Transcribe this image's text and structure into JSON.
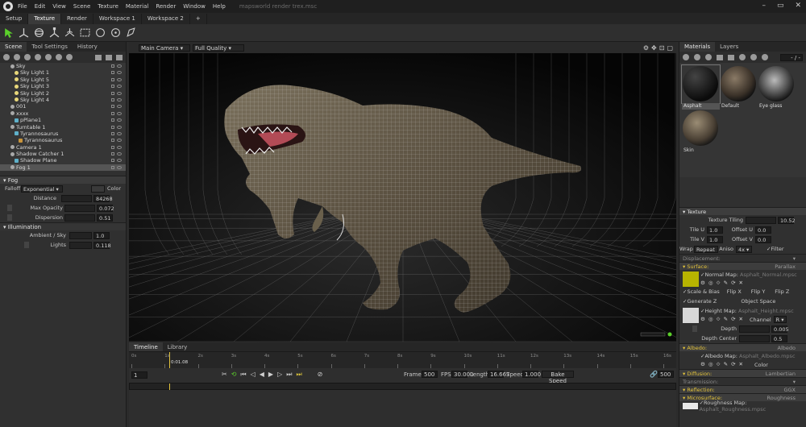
{
  "window": {
    "menu": [
      "File",
      "Edit",
      "View",
      "Scene",
      "Texture",
      "Material",
      "Render",
      "Window",
      "Help"
    ],
    "document": "mapsworld render trex.msc",
    "controls": [
      "–",
      "▭",
      "✕"
    ]
  },
  "workspace_tabs": [
    "Setup",
    "Texture",
    "Render",
    "Workspace 1",
    "Workspace 2",
    "+"
  ],
  "active_workspace_tab": 1,
  "colors": {
    "accent": "#e0b400",
    "select_green": "#5bd02b",
    "gold": "#e3c33b"
  },
  "left": {
    "tabs": [
      "Scene",
      "Tool Settings",
      "History"
    ],
    "tree": [
      {
        "label": "Sky",
        "indent": 1,
        "icon": "sky"
      },
      {
        "label": "Sky Light 1",
        "indent": 2,
        "icon": "light"
      },
      {
        "label": "Sky Light 5",
        "indent": 2,
        "icon": "light"
      },
      {
        "label": "Sky Light 3",
        "indent": 2,
        "icon": "light"
      },
      {
        "label": "Sky Light 2",
        "indent": 2,
        "icon": "light"
      },
      {
        "label": "Sky Light 4",
        "indent": 2,
        "icon": "light"
      },
      {
        "label": "001",
        "indent": 1,
        "icon": "group"
      },
      {
        "label": "xxxx",
        "indent": 1,
        "icon": "group"
      },
      {
        "label": "pPlane1",
        "indent": 2,
        "icon": "mesh"
      },
      {
        "label": "Turntable 1",
        "indent": 1,
        "icon": "turntable"
      },
      {
        "label": "Tyrannosaurus",
        "indent": 2,
        "icon": "mesh"
      },
      {
        "label": "Tyrannosaurus",
        "indent": 3,
        "icon": "dino"
      },
      {
        "label": "Camera 1",
        "indent": 1,
        "icon": "camera"
      },
      {
        "label": "Shadow Catcher 1",
        "indent": 1,
        "icon": "group"
      },
      {
        "label": "Shadow Plane",
        "indent": 2,
        "icon": "mesh"
      },
      {
        "label": "Fog 1",
        "indent": 1,
        "icon": "fog",
        "selected": true
      }
    ],
    "fog_section": "Fog",
    "falloff_label": "Falloff",
    "falloff_value": "Exponential",
    "color_label": "Color",
    "distance_label": "Distance",
    "distance_value": "84268",
    "max_opacity_label": "Max Opacity",
    "max_opacity_value": "0.072",
    "dispersion_label": "Dispersion",
    "dispersion_value": "0.51",
    "illumination_section": "Illumination",
    "ambient_label": "Ambient / Sky",
    "ambient_value": "1.0",
    "lights_label": "Lights",
    "lights_value": "0.118"
  },
  "viewport": {
    "camera": "Main Camera",
    "quality": "Full Quality"
  },
  "timeline": {
    "tabs": [
      "Timeline",
      "Library"
    ],
    "ticks": [
      "0s",
      "1s",
      "2s",
      "3s",
      "4s",
      "5s",
      "6s",
      "7s",
      "8s",
      "9s",
      "10s",
      "11s",
      "12s",
      "13s",
      "14s",
      "15s",
      "16s"
    ],
    "current_time": "0:01.08",
    "frame_field": "1",
    "frames_label": "Frames",
    "frames_value": "500",
    "fps_label": "FPS",
    "fps_value": "30.000",
    "length_label": "Length",
    "length_value": "16.667",
    "speed_label": "Speed",
    "speed_value": "1.000",
    "bake_label": "Bake Speed",
    "end_frame": "500"
  },
  "right": {
    "tabs": [
      "Materials",
      "Layers"
    ],
    "page": "- / -",
    "materials": [
      "Asphalt",
      "Default",
      "Eye glass",
      "Skin"
    ],
    "texture_section": "Texture",
    "texture_tiling_label": "Texture Tiling",
    "texture_tiling_value": "10.52",
    "tile_u_label": "Tile U",
    "tile_u_value": "1.0",
    "offset_u_label": "Offset U",
    "offset_u_value": "0.0",
    "tile_v_label": "Tile V",
    "tile_v_value": "1.0",
    "offset_v_label": "Offset V",
    "offset_v_value": "0.0",
    "wrap_label": "Wrap",
    "wrap_value": "Repeat",
    "aniso_label": "Aniso",
    "aniso_value": "4x",
    "filter_label": "Filter",
    "displacement_label": "Displacement:",
    "surface_label": "Surface:",
    "surface_value": "Parallax",
    "normal_map_label": "Normal Map:",
    "normal_map_file": "Asphalt_Normal.mpsc",
    "scale_bias_label": "Scale & Bias",
    "flip_x": "Flip X",
    "flip_y": "Flip Y",
    "flip_z": "Flip Z",
    "generate_z": "Generate Z",
    "object_space": "Object Space",
    "height_map_label": "Height Map:",
    "height_map_file": "Asphalt_Height.mpsc",
    "channel_label": "Channel",
    "channel_value": "R",
    "depth_label": "Depth",
    "depth_value": "0.005",
    "depth_center_label": "Depth Center",
    "depth_center_value": "0.5",
    "albedo_label": "Albedo:",
    "albedo_value": "Albedo",
    "albedo_map_label": "Albedo Map:",
    "albedo_map_file": "Asphalt_Albedo.mpsc",
    "color_label": "Color",
    "diffusion_label": "Diffusion:",
    "diffusion_value": "Lambertian",
    "transmission_label": "Transmission:",
    "reflection_label": "Reflection:",
    "reflection_value": "GGX",
    "microsurface_label": "Microsurface:",
    "microsurface_value": "Roughness",
    "roughness_map_label": "Roughness Map:",
    "roughness_map_file": "Asphalt_Roughness.mpsc"
  }
}
